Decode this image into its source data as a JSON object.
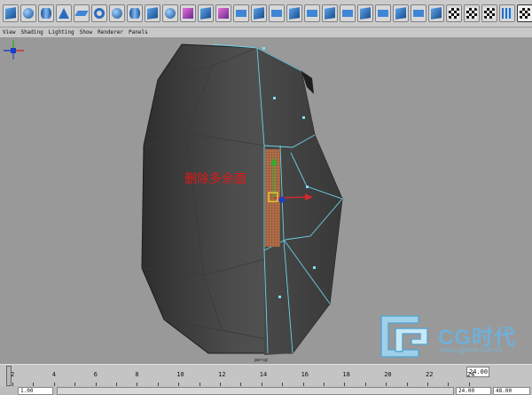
{
  "menu": [
    "View",
    "Shading",
    "Lighting",
    "Show",
    "Renderer",
    "Panels"
  ],
  "shelf_icons": [
    "cube-icon",
    "cube-icon",
    "cylinder-icon",
    "cone-icon",
    "plane-icon",
    "torus-icon",
    "sphere-icon",
    "cylinder-icon",
    "cube-icon",
    "sphere-icon",
    "cube-icon",
    "cube-icon",
    "cube-icon",
    "cube-icon",
    "cube-icon",
    "cube-icon",
    "cube-icon",
    "cube-icon",
    "cube-icon",
    "cube-icon",
    "cube-icon",
    "cube-icon",
    "cube-icon",
    "cube-icon",
    "cube-icon",
    "check-icon",
    "check-icon",
    "check-icon",
    "grid-icon",
    "check-icon"
  ],
  "viewport": {
    "annotation": "删除多余面",
    "camera": "persp"
  },
  "timeline": {
    "ticks": [
      "2",
      "4",
      "6",
      "8",
      "10",
      "12",
      "14",
      "16",
      "18",
      "20",
      "22",
      "24"
    ],
    "end_frame": "24.00"
  },
  "range": {
    "start": "1.00",
    "end": "24.00",
    "max": "48.00"
  },
  "watermark": {
    "text": "CG时代",
    "url": "www.cgtime.com.cn"
  },
  "colors": {
    "viewport_bg": "#999999",
    "wire": "#6fd0e8",
    "annotation": "#e01818"
  }
}
